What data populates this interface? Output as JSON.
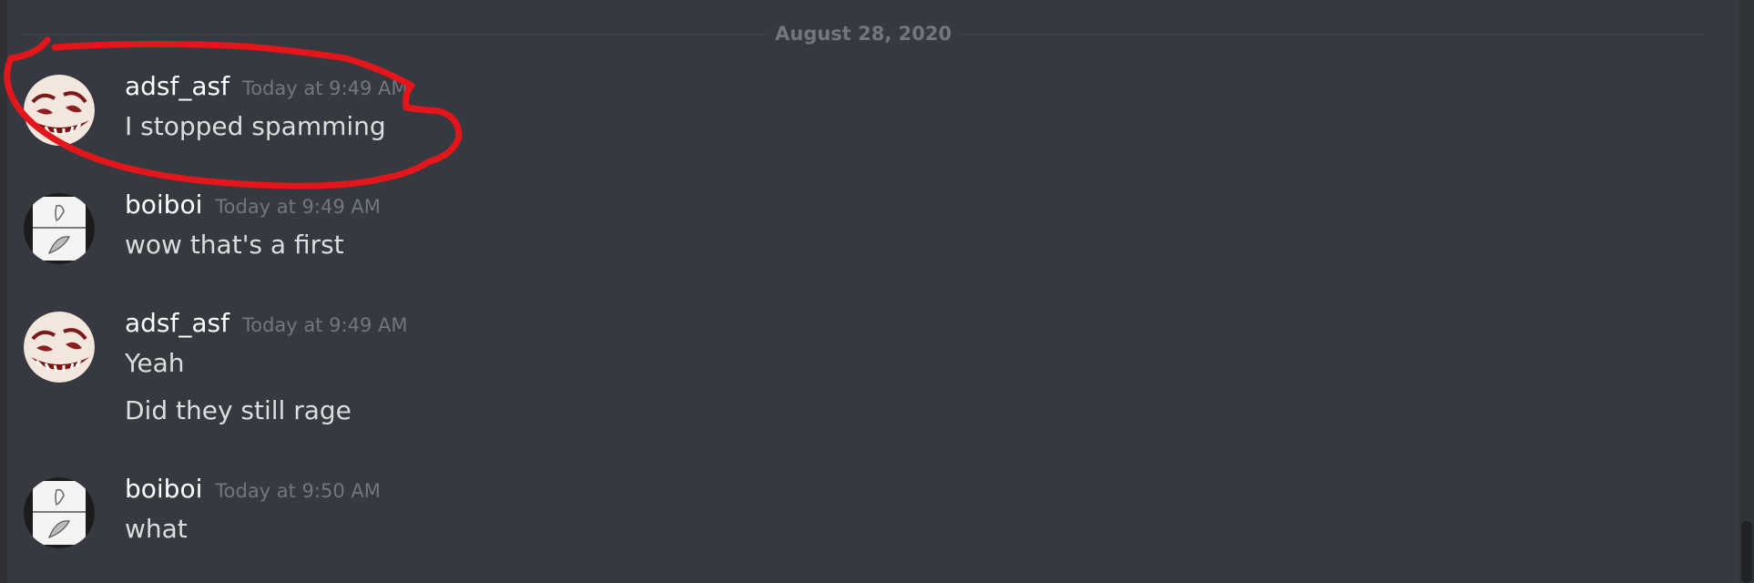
{
  "date_divider": "August 28, 2020",
  "messages": [
    {
      "username": "adsf_asf",
      "timestamp": "Today at 9:49 AM",
      "lines": [
        "I stopped spamming"
      ],
      "avatar": "trollface-avatar"
    },
    {
      "username": "boiboi",
      "timestamp": "Today at 9:49 AM",
      "lines": [
        "wow that's a first"
      ],
      "avatar": "comic-sketch-avatar"
    },
    {
      "username": "adsf_asf",
      "timestamp": "Today at 9:49 AM",
      "lines": [
        "Yeah",
        "Did they still rage"
      ],
      "avatar": "trollface-avatar"
    },
    {
      "username": "boiboi",
      "timestamp": "Today at 9:50 AM",
      "lines": [
        "what"
      ],
      "avatar": "comic-sketch-avatar"
    }
  ],
  "colors": {
    "background": "#36393f",
    "username": "#ffffff",
    "message_text": "#dcddde",
    "timestamp": "#72767d",
    "annotation": "#e3161c"
  }
}
